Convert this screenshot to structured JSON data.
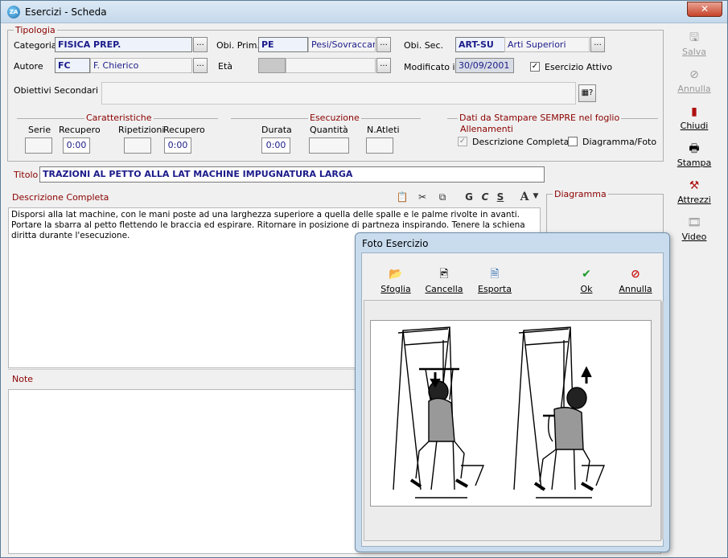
{
  "window": {
    "title": "Esercizi - Scheda",
    "close": "✕"
  },
  "tipologia": {
    "legend": "Tipologia",
    "categoria_label": "Categoria",
    "categoria_value": "FISICA PREP.",
    "obiprim_label": "Obi. Prim.",
    "obiprim_code": "PE",
    "obiprim_desc": "Pesi/Sovraccari",
    "obisec_label": "Obi. Sec.",
    "obisec_code": "ART-SU",
    "obisec_desc": "Arti Superiori",
    "autore_label": "Autore",
    "autore_code": "FC",
    "autore_desc": "F. Chierico",
    "eta_label": "Età",
    "modificato_label": "Modificato il",
    "modificato_value": "30/09/2001",
    "attivo_label": "Esercizio Attivo",
    "obiettivi_label": "Obiettivi Secondari",
    "dots": "..."
  },
  "caratteristiche": {
    "legend": "Caratteristiche",
    "serie_label": "Serie",
    "recupero1_label": "Recupero",
    "recupero1_value": "0:00",
    "ripetizioni_label": "Ripetizioni",
    "recupero2_label": "Recupero",
    "recupero2_value": "0:00"
  },
  "esecuzione": {
    "legend": "Esecuzione",
    "durata_label": "Durata",
    "durata_value": "0:00",
    "quantita_label": "Quantità",
    "natleti_label": "N.Atleti"
  },
  "stampa": {
    "legend": "Dati da Stampare SEMPRE nel foglio",
    "subtitle": "Allenamenti",
    "descrizione_label": "Descrizione Completa",
    "diagramma_label": "Diagramma/Foto"
  },
  "titolo": {
    "label": "Titolo",
    "value": "TRAZIONI AL PETTO ALLA LAT MACHINE IMPUGNATURA LARGA"
  },
  "descrizione": {
    "label": "Descrizione Completa",
    "text": "Disporsi alla lat machine, con le mani poste ad una larghezza superiore a quella delle spalle e le palme rivolte in avanti. Portare la sbarra al petto flettendo le braccia ed espirare. Ritornare in posizione di partneza inspirando. Tenere la schiena diritta durante l'esecuzione.",
    "toolbar": {
      "bold": "G",
      "italic": "C",
      "underline": "S",
      "font": "A"
    }
  },
  "diagramma": {
    "label": "Diagramma"
  },
  "note": {
    "label": "Note"
  },
  "sidebar": {
    "salva": "Salva",
    "annulla": "Annulla",
    "chiudi": "Chiudi",
    "stampa": "Stampa",
    "attrezzi": "Attrezzi",
    "video": "Video"
  },
  "foto_dialog": {
    "title": "Foto Esercizio",
    "sfoglia": "Sfoglia",
    "cancella": "Cancella",
    "esporta": "Esporta",
    "ok": "Ok",
    "annulla": "Annulla"
  }
}
